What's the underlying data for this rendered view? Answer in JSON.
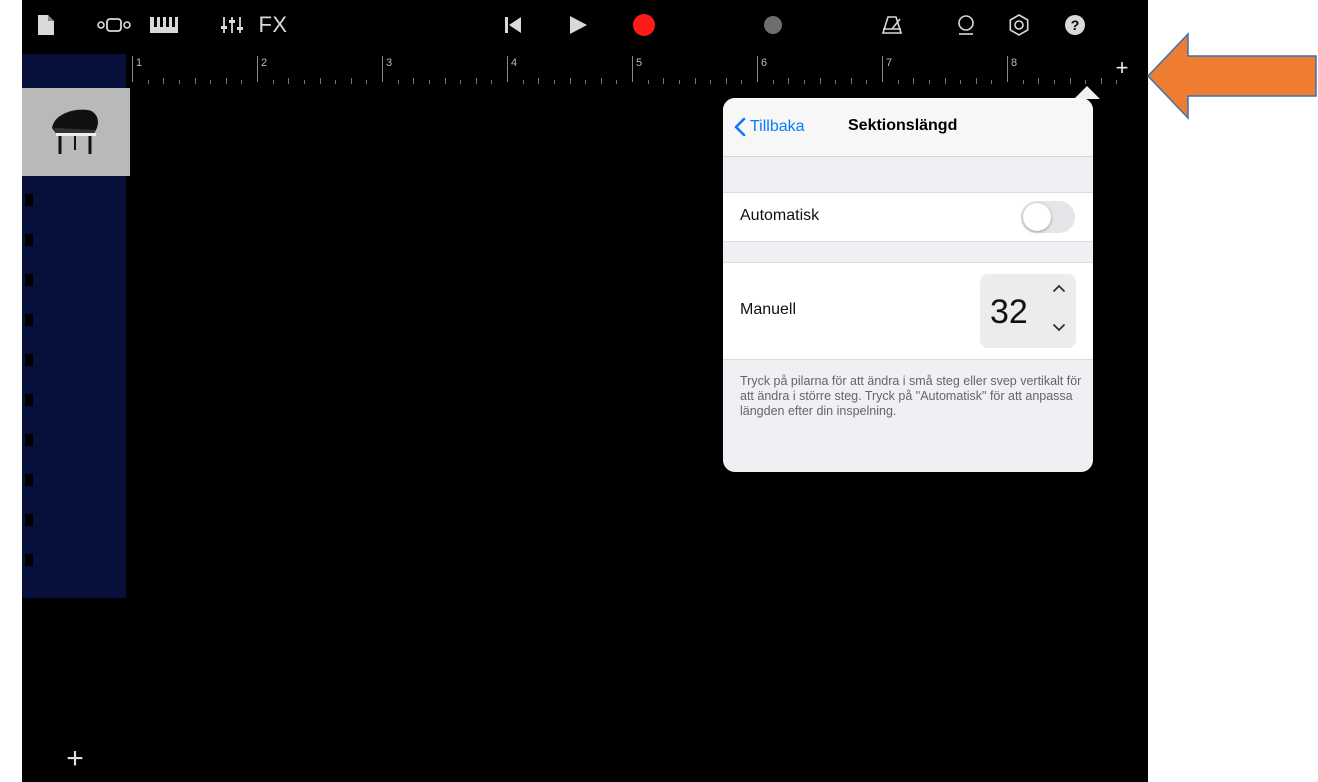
{
  "toolbar": {
    "fx_label": "FX"
  },
  "ruler": {
    "bars": [
      "1",
      "2",
      "3",
      "4",
      "5",
      "6",
      "7",
      "8"
    ],
    "add_label": "+"
  },
  "tracks": {
    "add_label": "+",
    "instrument": "grand-piano"
  },
  "popover": {
    "back_label": "Tillbaka",
    "title": "Sektionslängd",
    "auto_label": "Automatisk",
    "auto_on": false,
    "manual_label": "Manuell",
    "manual_value": "32",
    "hint": "Tryck på pilarna för att ändra i små steg eller svep vertikalt för att ändra i större steg. Tryck på \"Automatisk\" för att anpassa längden efter din inspelning."
  },
  "annotation": {
    "arrow_color": "#ee7d31"
  },
  "colors": {
    "accent": "#0a7aff",
    "record": "#ff1a1a",
    "track_column": "#06103a"
  }
}
